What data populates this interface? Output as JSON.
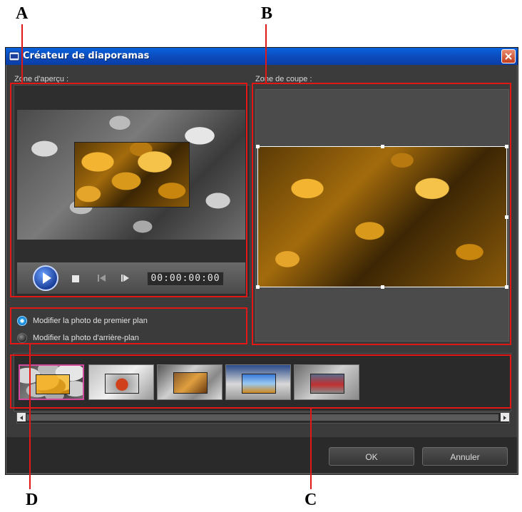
{
  "callouts": {
    "a": "A",
    "b": "B",
    "c": "C",
    "d": "D"
  },
  "window": {
    "title": "Créateur de diaporamas",
    "title_icon": "app-icon",
    "close_icon": "close-icon"
  },
  "preview": {
    "label": "Zone d'aperçu :",
    "timecode": "00:00:00:00",
    "controls": [
      "play-icon",
      "stop-icon",
      "previous-frame-icon",
      "next-frame-icon"
    ]
  },
  "crop": {
    "label": "Zone de coupe :"
  },
  "options": {
    "foreground": "Modifier la photo de premier plan",
    "background": "Modifier la photo d'arrière-plan",
    "selected": "foreground"
  },
  "thumbnails": {
    "count": 5,
    "selected_index": 0
  },
  "buttons": {
    "ok": "OK",
    "cancel": "Annuler"
  },
  "colors": {
    "annotation": "#e01818",
    "titlebar": "#0a58d0",
    "selection": "#d14aa0"
  }
}
